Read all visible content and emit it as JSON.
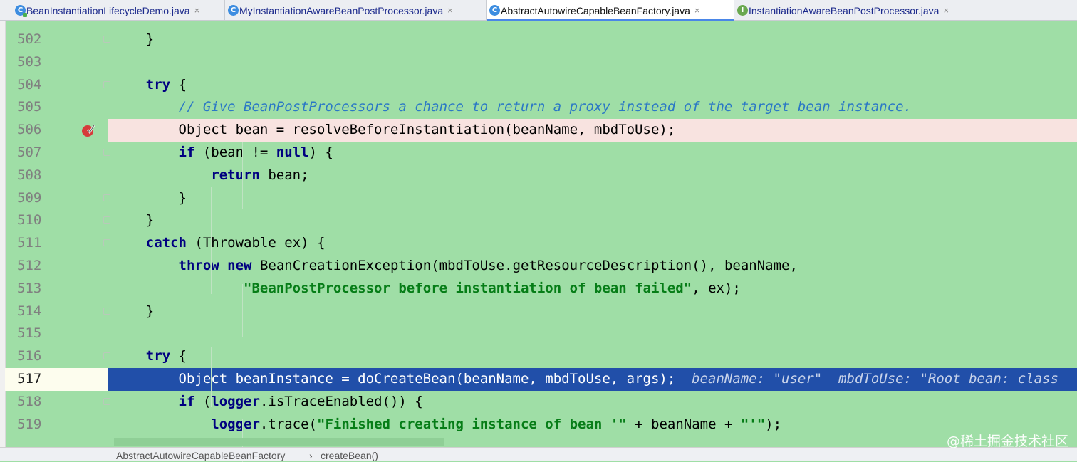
{
  "tabs": [
    {
      "label": "BeanInstantiationLifecycleDemo.java",
      "icon": "class-run-icon",
      "close": "×",
      "active": false
    },
    {
      "label": "MyInstantiationAwareBeanPostProcessor.java",
      "icon": "class-icon",
      "close": "×",
      "active": false
    },
    {
      "label": "AbstractAutowireCapableBeanFactory.java",
      "icon": "class-icon",
      "close": "×",
      "active": true
    },
    {
      "label": "InstantiationAwareBeanPostProcessor.java",
      "icon": "interface-icon",
      "close": "×",
      "active": false
    }
  ],
  "editor": {
    "lines": [
      {
        "num": "502",
        "code": [
          {
            "t": "    }",
            "c": ""
          }
        ]
      },
      {
        "num": "503",
        "code": []
      },
      {
        "num": "504",
        "code": [
          {
            "t": "    ",
            "c": ""
          },
          {
            "t": "try",
            "c": "kw"
          },
          {
            "t": " {",
            "c": ""
          }
        ]
      },
      {
        "num": "505",
        "code": [
          {
            "t": "        ",
            "c": ""
          },
          {
            "t": "// Give BeanPostProcessors a chance to return a proxy instead of the target bean instance.",
            "c": "cmt"
          }
        ]
      },
      {
        "num": "506",
        "code": [
          {
            "t": "        Object bean = resolveBeforeInstantiation(beanName, ",
            "c": ""
          },
          {
            "t": "mbdToUse",
            "c": "und"
          },
          {
            "t": ");",
            "c": ""
          }
        ],
        "breakpoint": true
      },
      {
        "num": "507",
        "code": [
          {
            "t": "        ",
            "c": ""
          },
          {
            "t": "if",
            "c": "kw"
          },
          {
            "t": " (bean != ",
            "c": ""
          },
          {
            "t": "null",
            "c": "kw"
          },
          {
            "t": ") {",
            "c": ""
          }
        ]
      },
      {
        "num": "508",
        "code": [
          {
            "t": "            ",
            "c": ""
          },
          {
            "t": "return",
            "c": "kw"
          },
          {
            "t": " bean;",
            "c": ""
          }
        ]
      },
      {
        "num": "509",
        "code": [
          {
            "t": "        }",
            "c": ""
          }
        ]
      },
      {
        "num": "510",
        "code": [
          {
            "t": "    }",
            "c": ""
          }
        ]
      },
      {
        "num": "511",
        "code": [
          {
            "t": "    ",
            "c": ""
          },
          {
            "t": "catch",
            "c": "kw"
          },
          {
            "t": " (Throwable ex) {",
            "c": ""
          }
        ]
      },
      {
        "num": "512",
        "code": [
          {
            "t": "        ",
            "c": ""
          },
          {
            "t": "throw",
            "c": "kw"
          },
          {
            "t": " ",
            "c": ""
          },
          {
            "t": "new",
            "c": "kw"
          },
          {
            "t": " BeanCreationException(",
            "c": ""
          },
          {
            "t": "mbdToUse",
            "c": "und"
          },
          {
            "t": ".getResourceDescription(), beanName,",
            "c": ""
          }
        ]
      },
      {
        "num": "513",
        "code": [
          {
            "t": "                ",
            "c": ""
          },
          {
            "t": "\"BeanPostProcessor before instantiation of bean failed\"",
            "c": "str"
          },
          {
            "t": ", ex);",
            "c": ""
          }
        ]
      },
      {
        "num": "514",
        "code": [
          {
            "t": "    }",
            "c": ""
          }
        ]
      },
      {
        "num": "515",
        "code": []
      },
      {
        "num": "516",
        "code": [
          {
            "t": "    ",
            "c": ""
          },
          {
            "t": "try",
            "c": "kw"
          },
          {
            "t": " {",
            "c": ""
          }
        ]
      },
      {
        "num": "517",
        "code": [
          {
            "t": "        Object beanInstance = doCreateBean(beanName, ",
            "c": ""
          },
          {
            "t": "mbdToUse",
            "c": "und"
          },
          {
            "t": ", args);  ",
            "c": ""
          },
          {
            "t": "beanName: \"user\"  mbdToUse: \"Root bean: class",
            "c": "hint"
          }
        ],
        "current": true
      },
      {
        "num": "518",
        "code": [
          {
            "t": "        ",
            "c": ""
          },
          {
            "t": "if",
            "c": "kw"
          },
          {
            "t": " (",
            "c": ""
          },
          {
            "t": "logger",
            "c": "kw"
          },
          {
            "t": ".isTraceEnabled()) {",
            "c": ""
          }
        ]
      },
      {
        "num": "519",
        "code": [
          {
            "t": "            ",
            "c": ""
          },
          {
            "t": "logger",
            "c": "kw"
          },
          {
            "t": ".trace(",
            "c": ""
          },
          {
            "t": "\"Finished creating instance of bean '\"",
            "c": "str"
          },
          {
            "t": " + beanName + ",
            "c": ""
          },
          {
            "t": "\"'\"",
            "c": "str"
          },
          {
            "t": ");",
            "c": ""
          }
        ]
      }
    ]
  },
  "breadcrumb": {
    "items": [
      "AbstractAutowireCapableBeanFactory",
      "createBean()"
    ],
    "separator": "›"
  },
  "watermark": "@稀土掘金技术社区"
}
